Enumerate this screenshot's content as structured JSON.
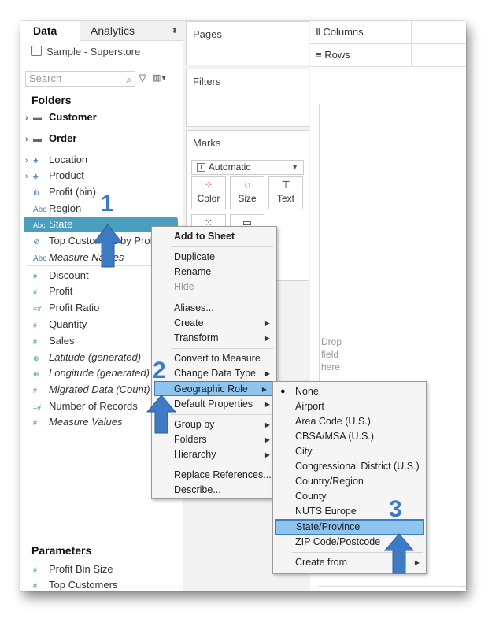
{
  "tabs": {
    "data": "Data",
    "analytics": "Analytics"
  },
  "datasource": "Sample - Superstore",
  "search": {
    "placeholder": "Search"
  },
  "folders_heading": "Folders",
  "folders": [
    {
      "label": "Customer"
    },
    {
      "label": "Order"
    }
  ],
  "dimensions": [
    {
      "label": "Location",
      "icon": "hierarchy"
    },
    {
      "label": "Product",
      "icon": "hierarchy"
    },
    {
      "label": "Profit (bin)",
      "icon": "bin"
    },
    {
      "label": "Region",
      "icon": "Abc"
    },
    {
      "label": "State",
      "icon": "Abc"
    },
    {
      "label": "Top Customers by Profit",
      "icon": "set"
    },
    {
      "label": "Measure Names",
      "icon": "Abc"
    }
  ],
  "measures": [
    {
      "label": "Discount"
    },
    {
      "label": "Profit"
    },
    {
      "label": "Profit Ratio"
    },
    {
      "label": "Quantity"
    },
    {
      "label": "Sales"
    },
    {
      "label": "Latitude (generated)"
    },
    {
      "label": "Longitude (generated)"
    },
    {
      "label": "Migrated Data (Count)"
    },
    {
      "label": "Number of Records"
    },
    {
      "label": "Measure Values"
    }
  ],
  "parameters_heading": "Parameters",
  "parameters": [
    {
      "label": "Profit Bin Size"
    },
    {
      "label": "Top Customers"
    }
  ],
  "cards": {
    "pages": "Pages",
    "filters": "Filters",
    "marks": "Marks"
  },
  "marks": {
    "mark_type": "Automatic",
    "buttons": {
      "color": "Color",
      "size": "Size",
      "text": "Text"
    }
  },
  "shelves": {
    "columns": "Columns",
    "rows": "Rows"
  },
  "drop_hint": [
    "Drop",
    "field",
    "here"
  ],
  "context_menu": {
    "title": "Add to Sheet",
    "items": [
      "Duplicate",
      "Rename",
      "Hide",
      "Aliases...",
      "Create",
      "Transform",
      "Convert to Measure",
      "Change Data Type",
      "Geographic Role",
      "Default Properties",
      "Group by",
      "Folders",
      "Hierarchy",
      "Replace References...",
      "Describe..."
    ]
  },
  "geo_menu": {
    "items": [
      "None",
      "Airport",
      "Area Code (U.S.)",
      "CBSA/MSA (U.S.)",
      "City",
      "Congressional District (U.S.)",
      "Country/Region",
      "County",
      "NUTS Europe",
      "State/Province",
      "ZIP Code/Postcode",
      "Create from"
    ],
    "selected": "State/Province",
    "checked": "None"
  },
  "annotations": {
    "step1": "1",
    "step2": "2",
    "step3": "3",
    "arrow_color": "#3e7bc4"
  },
  "colors": {
    "pill": "#4b9fbe",
    "highlight": "#8ec4ee",
    "highlight_border": "#3c7fc0"
  }
}
